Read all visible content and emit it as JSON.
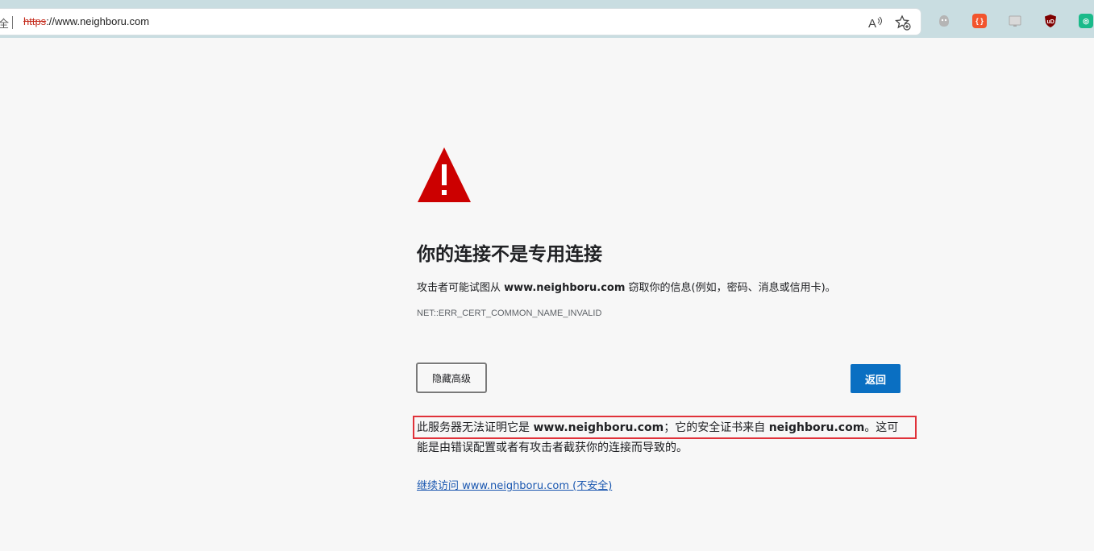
{
  "browser": {
    "lock_label": "全",
    "url_scheme": "https",
    "url_rest": "://www.neighboru.com",
    "read_aloud_label": "A",
    "extensions": [
      {
        "name": "ghostery",
        "color": "#a9a9a9"
      },
      {
        "name": "json-viewer",
        "color": "#f2542d",
        "text": "{}"
      },
      {
        "name": "translate",
        "color": "#c9c9c9"
      },
      {
        "name": "ublock",
        "color": "#800000",
        "text": "uD"
      },
      {
        "name": "tampermonkey",
        "color": "#1aba8a",
        "text": "◎"
      }
    ]
  },
  "page": {
    "headline": "你的连接不是专用连接",
    "desc_prefix": "攻击者可能试图从 ",
    "desc_domain": "www.neighboru.com",
    "desc_suffix": " 窃取你的信息(例如，密码、消息或信用卡)。",
    "error_code": "NET::ERR_CERT_COMMON_NAME_INVALID",
    "advanced_button": "隐藏高级",
    "back_button": "返回",
    "detail_1": "此服务器无法证明它是 ",
    "detail_domain_1": "www.neighboru.com",
    "detail_2": "；它的安全证书来自 ",
    "detail_domain_2": "neighboru.com",
    "detail_3": "。这可能是由错误配置或者有攻击者截获你的连接而导致的。",
    "proceed_link": "继续访问 www.neighboru.com (不安全)"
  },
  "colors": {
    "warning_red": "#cc0000",
    "back_button_blue": "#0a6fc2",
    "link_blue": "#1a57b0",
    "highlight_red": "#e0323a"
  }
}
